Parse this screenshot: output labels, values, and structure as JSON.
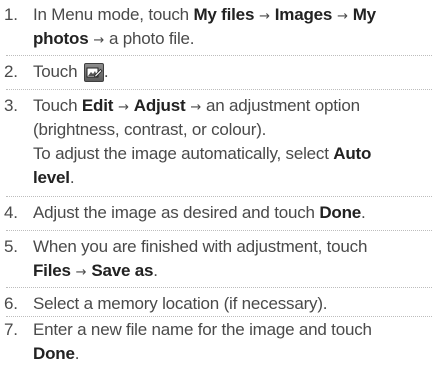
{
  "steps": [
    {
      "number": "1.",
      "lines": [
        [
          {
            "t": "In Menu mode, touch ",
            "b": false
          },
          {
            "t": "My files",
            "b": true
          },
          {
            "t": " → ",
            "b": false,
            "a": true
          },
          {
            "t": "Images",
            "b": true
          },
          {
            "t": " → ",
            "b": false,
            "a": true
          },
          {
            "t": "My",
            "b": true
          }
        ],
        [
          {
            "t": "photos",
            "b": true
          },
          {
            "t": " → ",
            "b": false,
            "a": true
          },
          {
            "t": "a photo file.",
            "b": false
          }
        ]
      ]
    },
    {
      "number": "2.",
      "icon": "edit-photo-icon",
      "lines": [
        [
          {
            "t": "Touch ",
            "b": false
          },
          {
            "icon": true
          },
          {
            "t": ".",
            "b": false
          }
        ]
      ]
    },
    {
      "number": "3.",
      "lines": [
        [
          {
            "t": "Touch ",
            "b": false
          },
          {
            "t": "Edit",
            "b": true
          },
          {
            "t": " → ",
            "b": false,
            "a": true
          },
          {
            "t": "Adjust",
            "b": true
          },
          {
            "t": " → ",
            "b": false,
            "a": true
          },
          {
            "t": "an adjustment option",
            "b": false
          }
        ],
        [
          {
            "t": "(brightness, contrast, or colour).",
            "b": false
          }
        ],
        [
          {
            "t": "To adjust the image automatically, select ",
            "b": false
          },
          {
            "t": "Auto",
            "b": true
          }
        ],
        [
          {
            "t": "level",
            "b": true
          },
          {
            "t": ".",
            "b": false
          }
        ]
      ]
    },
    {
      "number": "4.",
      "lines": [
        [
          {
            "t": "Adjust the image as desired and touch ",
            "b": false
          },
          {
            "t": "Done",
            "b": true
          },
          {
            "t": ".",
            "b": false
          }
        ]
      ]
    },
    {
      "number": "5.",
      "lines": [
        [
          {
            "t": "When you are finished with adjustment, touch",
            "b": false
          }
        ],
        [
          {
            "t": "Files",
            "b": true
          },
          {
            "t": " → ",
            "b": false,
            "a": true
          },
          {
            "t": "Save as",
            "b": true
          },
          {
            "t": ".",
            "b": false
          }
        ]
      ]
    },
    {
      "number": "6.",
      "lines": [
        [
          {
            "t": "Select a memory location (if necessary).",
            "b": false
          }
        ]
      ]
    },
    {
      "number": "7.",
      "lines": [
        [
          {
            "t": "Enter a new file name for the image and touch",
            "b": false
          }
        ],
        [
          {
            "t": "Done",
            "b": true
          },
          {
            "t": ".",
            "b": false
          }
        ]
      ]
    }
  ]
}
